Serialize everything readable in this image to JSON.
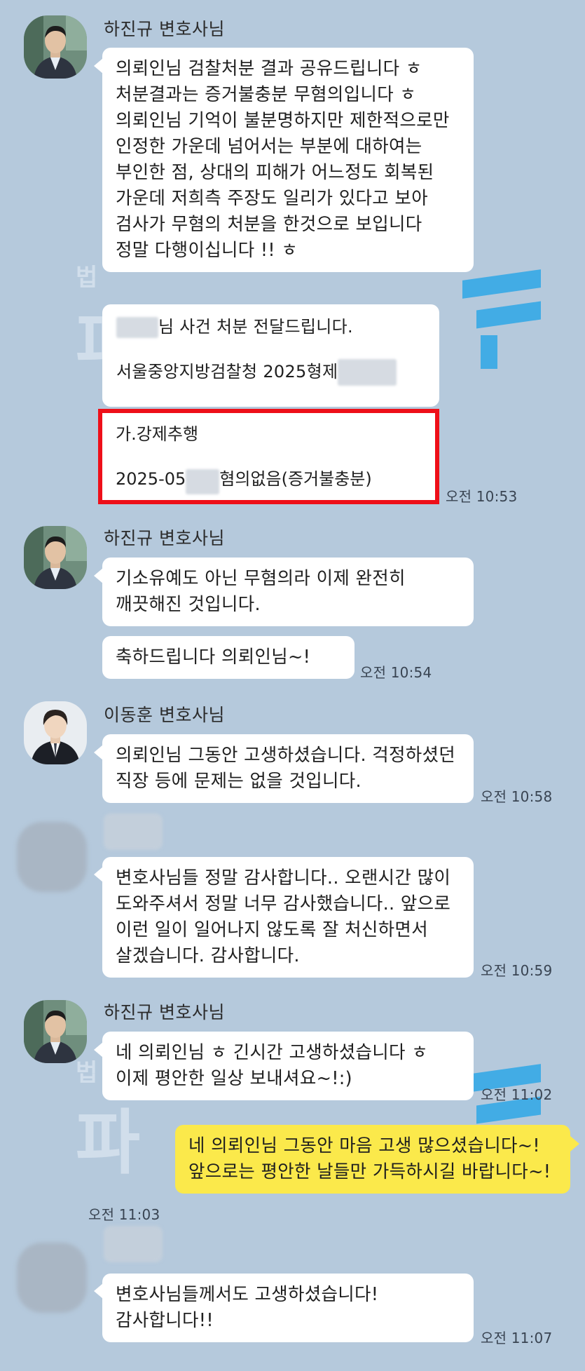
{
  "messages": {
    "m1": {
      "sender": "하진규 변호사님",
      "text": "의뢰인님 검찰처분 결과 공유드립니다 ㅎ 처분결과는 증거불충분 무혐의입니다 ㅎ 의뢰인님 기억이 불분명하지만 제한적으로만 인정한 가운데 넘어서는 부분에 대하여는 부인한 점, 상대의 피해가 어느정도 회복된 가운데 저희측 주장도 일리가 있다고 보아 검사가 무혐의 처분을 한것으로 보입니다 정말 다행이십니다 !! ㅎ",
      "doc": {
        "line1_suffix": "님 사건 처분 전달드립니다.",
        "line2_prefix": "서울중앙지방검찰청 2025형제",
        "charge": "가.강제추행",
        "result_prefix": "2025-05",
        "result_suffix": "혐의없음(증거불충분)"
      },
      "time": "오전 10:53"
    },
    "m2": {
      "sender": "하진규 변호사님",
      "text1": "기소유예도 아닌 무혐의라 이제 완전히 깨끗해진 것입니다.",
      "text2": "축하드립니다 의뢰인님~!",
      "time": "오전 10:54"
    },
    "m3": {
      "sender": "이동훈 변호사님",
      "text": "의뢰인님 그동안 고생하셨습니다. 걱정하셨던 직장 등에 문제는 없을 것입니다.",
      "time": "오전 10:58"
    },
    "m4": {
      "text": "변호사님들 정말 감사합니다.. 오랜시간 많이 도와주셔서 정말 너무 감사했습니다.. 앞으로 이런 일이 일어나지 않도록 잘 처신하면서 살겠습니다. 감사합니다.",
      "time": "오전 10:59"
    },
    "m5": {
      "sender": "하진규 변호사님",
      "text": "네 의뢰인님 ㅎ 긴시간 고생하셨습니다 ㅎ 이제 평안한 일상 보내셔요~!:)",
      "time": "오전 11:02"
    },
    "m6": {
      "text": "네 의뢰인님 그동안 마음 고생 많으셨습니다~! 앞으로는 평안한 날들만 가득하시길 바랍니다~!",
      "time": "오전 11:03"
    },
    "m7": {
      "text": "변호사님들께서도 고생하셨습니다! 감사합니다!!",
      "time": "오전 11:07"
    }
  },
  "watermark": {
    "small": "법",
    "large": "파"
  },
  "colors": {
    "background": "#b5c9dc",
    "bubble": "#ffffff",
    "my_bubble": "#fbe94b",
    "highlight": "#ee0f19"
  }
}
